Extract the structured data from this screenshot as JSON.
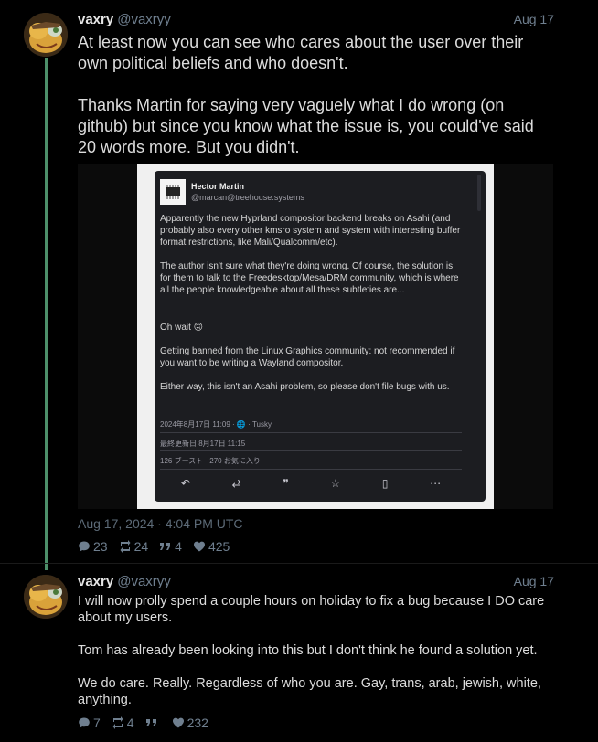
{
  "tweets": [
    {
      "user": "vaxry",
      "handle": "@vaxryy",
      "date": "Aug 17",
      "text": "At least now you can see who cares about the user over their own political beliefs and who doesn't.\n\nThanks Martin for saying very vaguely what I do wrong (on github) but since you know what the issue is, you could've said 20 words more. But you didn't.",
      "timestamp": "Aug 17, 2024 · 4:04 PM UTC",
      "stats": {
        "replies": "23",
        "retweets": "24",
        "quotes": "4",
        "likes": "425"
      },
      "embedded_post": {
        "name": "Hector Martin",
        "handle": "@marcan@treehouse.systems",
        "p1": "Apparently the new Hyprland compositor backend breaks on Asahi (and probably also every other kmsro system and system with interesting buffer format restrictions, like Mali/Qualcomm/etc).",
        "p2": "The author isn't sure what they're doing wrong. Of course, the solution is for them to talk to the Freedesktop/Mesa/DRM community, which is where all the people knowledgeable about all these subtleties are...",
        "p3": "Oh wait 🙃",
        "p4": "Getting banned from the Linux Graphics community: not recommended if you want to be writing a Wayland compositor.",
        "p5": "Either way, this isn't an Asahi problem, so please don't file bugs with us.",
        "meta": "2024年8月17日 11:09 · 🌐 · Tusky",
        "edited": "最終更新日 8月17日 11:15",
        "counts": "126 ブースト · 270 お気に入り"
      }
    },
    {
      "user": "vaxry",
      "handle": "@vaxryy",
      "date": "Aug 17",
      "text": "I will now prolly spend a couple hours on holiday to fix a bug because I DO care about my users.\n\nTom has already been looking into this but I don't think he found a solution yet.\n\nWe do care. Really. Regardless of who you are. Gay, trans, arab, jewish, white, anything.",
      "stats": {
        "replies": "7",
        "retweets": "4",
        "quotes": "",
        "likes": "232"
      }
    }
  ],
  "colors": {
    "background": "#000000",
    "thread_line": "#4d8f6a",
    "muted": "#6f7f8f"
  }
}
